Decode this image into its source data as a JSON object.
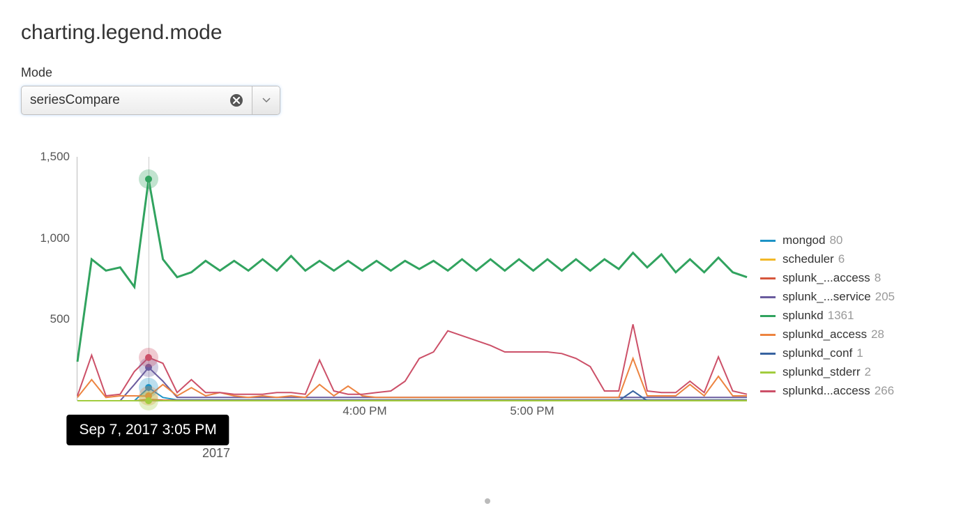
{
  "page_title": "charting.legend.mode",
  "mode": {
    "label": "Mode",
    "value": "seriesCompare"
  },
  "tooltip": "Sep 7, 2017 3:05 PM",
  "x_sub_label": "2017",
  "chart_data": {
    "type": "line",
    "ylim": [
      0,
      1500
    ],
    "yticks": [
      500,
      1000,
      1500
    ],
    "xticks": [
      {
        "pos": 413,
        "label": "4:00 PM"
      },
      {
        "pos": 653,
        "label": "5:00 PM"
      }
    ],
    "hover_index": 5,
    "n_points": 48,
    "series": [
      {
        "name": "mongod",
        "color": "#1e93c6",
        "hover_value": 80,
        "values": [
          0,
          0,
          0,
          0,
          0,
          80,
          20,
          5,
          5,
          5,
          5,
          5,
          5,
          5,
          5,
          5,
          5,
          5,
          5,
          5,
          5,
          5,
          5,
          5,
          5,
          5,
          5,
          5,
          5,
          5,
          5,
          5,
          5,
          5,
          5,
          5,
          5,
          5,
          5,
          5,
          5,
          5,
          5,
          5,
          5,
          5,
          5,
          5
        ]
      },
      {
        "name": "scheduler",
        "color": "#f2b827",
        "hover_value": 6,
        "values": [
          0,
          0,
          0,
          0,
          0,
          6,
          3,
          2,
          2,
          2,
          2,
          2,
          2,
          2,
          2,
          2,
          2,
          2,
          2,
          2,
          2,
          2,
          2,
          2,
          2,
          2,
          2,
          2,
          2,
          2,
          2,
          2,
          2,
          2,
          2,
          2,
          2,
          2,
          2,
          2,
          2,
          2,
          2,
          2,
          2,
          2,
          2,
          2
        ]
      },
      {
        "name": "splunk_...access",
        "color": "#d6563c",
        "hover_value": 8,
        "values": [
          0,
          0,
          0,
          0,
          0,
          8,
          4,
          2,
          2,
          2,
          2,
          2,
          2,
          2,
          2,
          2,
          2,
          2,
          2,
          2,
          2,
          2,
          2,
          2,
          2,
          2,
          2,
          2,
          2,
          2,
          2,
          2,
          2,
          2,
          2,
          2,
          2,
          2,
          2,
          2,
          2,
          2,
          2,
          2,
          2,
          2,
          2,
          2
        ]
      },
      {
        "name": "splunk_...service",
        "color": "#6a5c9e",
        "hover_value": 205,
        "values": [
          0,
          0,
          0,
          0,
          100,
          205,
          120,
          20,
          20,
          20,
          20,
          20,
          20,
          20,
          20,
          20,
          20,
          20,
          20,
          20,
          20,
          20,
          20,
          20,
          20,
          20,
          20,
          20,
          20,
          20,
          20,
          20,
          20,
          20,
          20,
          20,
          20,
          20,
          20,
          20,
          20,
          20,
          20,
          20,
          20,
          20,
          20,
          20
        ]
      },
      {
        "name": "splunkd",
        "color": "#31a35f",
        "hover_value": 1361,
        "values": [
          240,
          870,
          800,
          820,
          700,
          1361,
          870,
          760,
          790,
          860,
          800,
          860,
          800,
          870,
          800,
          890,
          800,
          860,
          800,
          860,
          800,
          860,
          800,
          860,
          810,
          860,
          800,
          870,
          800,
          870,
          800,
          870,
          800,
          870,
          800,
          870,
          800,
          870,
          810,
          910,
          820,
          900,
          790,
          870,
          790,
          880,
          790,
          760
        ]
      },
      {
        "name": "splunkd_access",
        "color": "#ed8440",
        "hover_value": 28,
        "values": [
          20,
          130,
          20,
          30,
          30,
          28,
          100,
          30,
          80,
          30,
          50,
          30,
          20,
          30,
          20,
          30,
          20,
          100,
          30,
          90,
          30,
          20,
          20,
          20,
          20,
          20,
          20,
          20,
          20,
          20,
          20,
          20,
          20,
          20,
          20,
          20,
          20,
          20,
          20,
          260,
          30,
          30,
          30,
          100,
          30,
          150,
          30,
          30
        ]
      },
      {
        "name": "splunkd_conf",
        "color": "#3863a0",
        "hover_value": 1,
        "values": [
          0,
          0,
          0,
          0,
          0,
          1,
          0,
          0,
          0,
          0,
          0,
          0,
          0,
          0,
          0,
          0,
          0,
          0,
          0,
          0,
          0,
          0,
          0,
          0,
          0,
          0,
          0,
          0,
          0,
          0,
          0,
          0,
          0,
          0,
          0,
          0,
          0,
          0,
          0,
          60,
          0,
          0,
          0,
          0,
          0,
          0,
          0,
          0
        ]
      },
      {
        "name": "splunkd_stderr",
        "color": "#a2cc3e",
        "hover_value": 2,
        "values": [
          0,
          0,
          0,
          0,
          0,
          2,
          0,
          0,
          0,
          0,
          0,
          0,
          0,
          0,
          0,
          0,
          0,
          0,
          0,
          0,
          0,
          0,
          0,
          0,
          0,
          0,
          0,
          0,
          0,
          0,
          0,
          0,
          0,
          0,
          0,
          0,
          0,
          0,
          0,
          0,
          0,
          0,
          0,
          0,
          0,
          0,
          0,
          0
        ]
      },
      {
        "name": "splunkd...access",
        "color": "#cc5068",
        "hover_value": 266,
        "values": [
          30,
          280,
          30,
          40,
          180,
          266,
          230,
          50,
          130,
          50,
          50,
          40,
          40,
          40,
          50,
          50,
          40,
          250,
          60,
          40,
          40,
          50,
          60,
          120,
          260,
          300,
          430,
          400,
          370,
          340,
          300,
          300,
          300,
          300,
          290,
          260,
          210,
          60,
          60,
          470,
          60,
          50,
          50,
          120,
          50,
          270,
          60,
          40
        ]
      }
    ]
  }
}
